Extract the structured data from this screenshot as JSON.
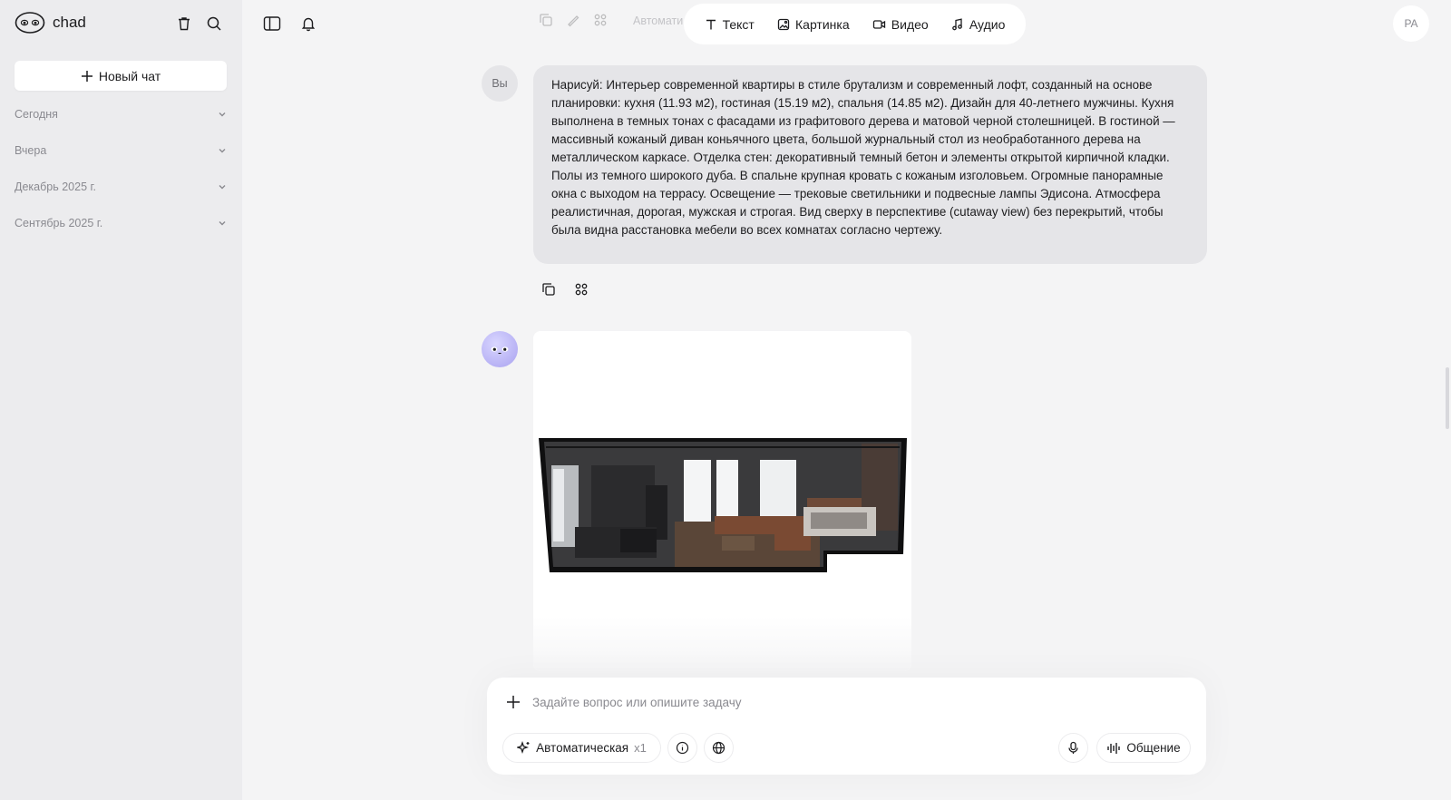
{
  "sidebar": {
    "brand": "chad",
    "new_chat_label": "Новый чат",
    "groups": [
      {
        "label": "Сегодня"
      },
      {
        "label": "Вчера"
      },
      {
        "label": "Декабрь 2025 г."
      },
      {
        "label": "Сентябрь 2025 г."
      }
    ]
  },
  "toolbar": {
    "faded_label": "Автомати",
    "modes": [
      {
        "label": "Текст",
        "icon": "text-icon"
      },
      {
        "label": "Картинка",
        "icon": "image-icon"
      },
      {
        "label": "Видео",
        "icon": "video-icon"
      },
      {
        "label": "Аудио",
        "icon": "music-note-icon"
      }
    ],
    "user_initials": "PA"
  },
  "messages": {
    "user_label": "Вы",
    "user_text": "Нарисуй: Интерьер современной квартиры в стиле брутализм и современный лофт, созданный на основе планировки: кухня (11.93 м2), гостиная (15.19 м2), спальня (14.85 м2). Дизайн для 40-летнего мужчины. Кухня выполнена в темных тонах с фасадами из графитового дерева и матовой черной столешницей. В гостиной — массивный кожаный диван коньячного цвета, большой журнальный стол из необработанного дерева на металлическом каркасе. Отделка стен: декоративный темный бетон и элементы открытой кирпичной кладки. Полы из темного широкого дуба. В спальне крупная кровать с кожаным изголовьем. Огромные панорамные окна с выходом на террасу. Освещение — трековые светильники и подвесные лампы Эдисона. Атмосфера реалистичная, дорогая, мужская и строгая. Вид сверху в перспективе (cutaway view) без перекрытий, чтобы была видна расстановка мебели во всех комнатах согласно чертежу."
  },
  "composer": {
    "placeholder": "Задайте вопрос или опишите задачу",
    "value": "",
    "model_label": "Автоматическая",
    "multiplier": "x1",
    "voice_label": "Общение"
  }
}
